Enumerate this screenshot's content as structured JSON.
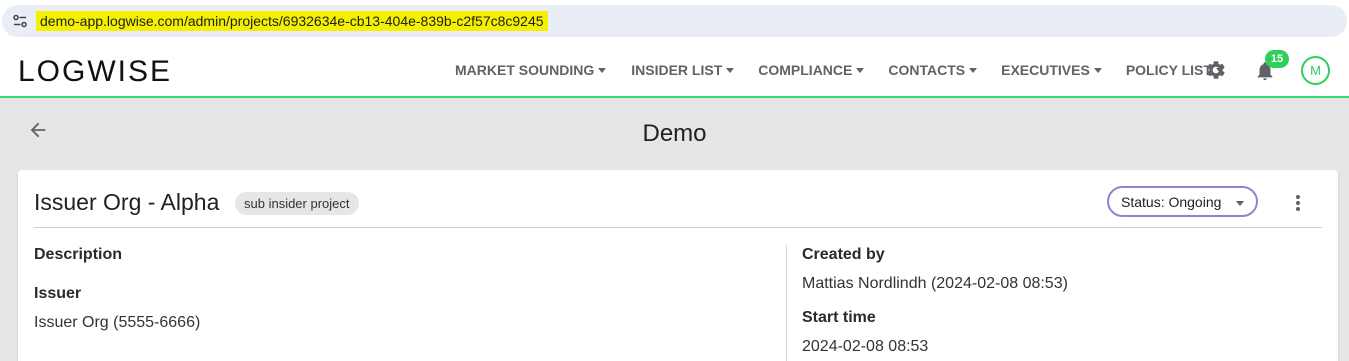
{
  "browser": {
    "url": "demo-app.logwise.com/admin/projects/6932634e-cb13-404e-839b-c2f57c8c9245"
  },
  "header": {
    "logo": "LOGWISE",
    "nav": [
      {
        "label": "MARKET SOUNDING"
      },
      {
        "label": "INSIDER LIST"
      },
      {
        "label": "COMPLIANCE"
      },
      {
        "label": "CONTACTS"
      },
      {
        "label": "EXECUTIVES"
      },
      {
        "label": "POLICY LIST"
      }
    ],
    "notification_count": "15",
    "avatar_initial": "M"
  },
  "page": {
    "title": "Demo"
  },
  "project": {
    "name": "Issuer Org - Alpha",
    "tag": "sub insider project",
    "status": "Status: Ongoing",
    "fields": {
      "description_label": "Description",
      "issuer_label": "Issuer",
      "issuer_value": "Issuer Org (5555-6666)",
      "created_by_label": "Created by",
      "created_by_value": "Mattias Nordlindh (2024-02-08 08:53)",
      "start_time_label": "Start time",
      "start_time_value": "2024-02-08 08:53"
    }
  },
  "colors": {
    "accent_green": "#2fcf5a",
    "status_outline": "#8b86d4",
    "url_highlight": "#f4f000"
  }
}
